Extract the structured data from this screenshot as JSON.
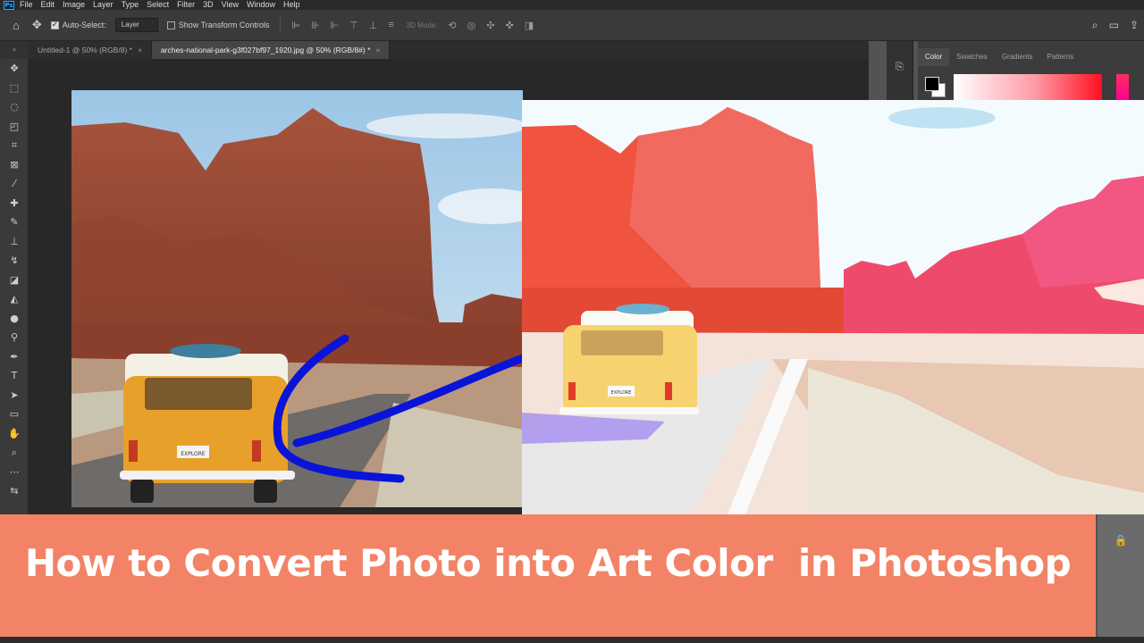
{
  "app": {
    "logo": "Ps"
  },
  "menu": [
    "File",
    "Edit",
    "Image",
    "Layer",
    "Type",
    "Select",
    "Filter",
    "3D",
    "View",
    "Window",
    "Help"
  ],
  "options": {
    "auto_select_label": "Auto-Select:",
    "auto_select_target": "Layer",
    "transform_label": "Show Transform Controls",
    "mode_3d_label": "3D Mode:"
  },
  "tabs": [
    {
      "label": "Untitled-1 @ 50% (RGB/8) *",
      "close": "×"
    },
    {
      "label": "arches-national-park-g3f027bf97_1920.jpg @ 50% (RGB/8#) *",
      "close": "×"
    }
  ],
  "color_panel": {
    "tabs": [
      "Color",
      "Swatches",
      "Gradients",
      "Patterns"
    ],
    "foreground": "#000000",
    "background": "#ffffff"
  },
  "banner": {
    "title": "How to Convert Photo into Art Color  in Photoshop",
    "color": "#f38367"
  },
  "plates": {
    "van": "EXPLORE"
  },
  "colors": {
    "arrow": "#0a14d8"
  }
}
